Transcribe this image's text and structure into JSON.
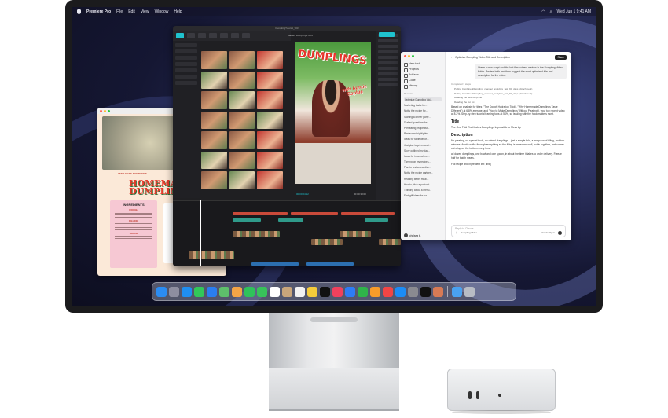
{
  "menubar": {
    "app_name": "Premiere Pro",
    "items": [
      "File",
      "Edit",
      "View",
      "Window",
      "Help"
    ],
    "clock": "Wed Jun 1  9:41 AM"
  },
  "recipe_doc": {
    "tag": "LET'S MAKE DUMPLINGS",
    "headline_line1": "HOMEMA",
    "headline_line2": "DUMPLINGS I",
    "card_title": "INGREDIENTS",
    "sections": [
      "DOUGH",
      "FILLING",
      "SAUCE"
    ]
  },
  "editor": {
    "window_title": "DumplingTutorial_v03",
    "preview_label": "Master: Dumplings.mp4",
    "preview_title": "DUMPLINGS",
    "preview_subtitle": "with Auntie Sophie",
    "timecode_current": "00:00:04:12",
    "timecode_total": "00:00:38:00"
  },
  "chat": {
    "sidebar_nav": [
      "New task",
      "Projects",
      "Artifacts",
      "Code",
      "History"
    ],
    "recents_label": "Recents",
    "history": [
      "Optimize Dumpling Vid...",
      "Marketing tasks for...",
      "Notify the recipe for...",
      "Starting a dinner party...",
      "Drafted questions for...",
      "Preheating recipe list...",
      "Restaurant highlights...",
      "Ideas for table decor...",
      "Just play together and...",
      "Story outlined my day...",
      "Ideas for informal me...",
      "Turning on my recipes...",
      "Plan to test a new dish...",
      "Notify the recipe partner...",
      "Reading better meal...",
      "How to pitch a podcast...",
      "Thinking about a menu...",
      "Find gift ideas for pa..."
    ],
    "user_name": "chelsea b.",
    "header_title": "Optimize Dumpling Video Title and Description",
    "share_label": "Share",
    "user_message": "I have a new script and the last film cut and metrics in the Dumpling Video folder. Review both and then suggest the most optimized title and description for the video.",
    "meta_label": "Completed 3 steps",
    "steps": [
      "Pulling Combined/dumpling_channel_analytics_last_90_days (Attachment)",
      "Pulling Combined/dumpling_channel_analytics_last_90_days (Attachment)",
      "Reading the new script file",
      "Reading the cut list"
    ],
    "body_intro": "Based on analysis for titles (\"The Dough Hydration Trick\", \"Why Homemade Dumplings Taste Different\") at 6.8% average, and \"How to Make Dumplings Without Pleating\"), your top recent video at 8.2%. Step-by-step tutorial framing tops at 54%, so leading with the hook matters most.",
    "title_heading": "Title",
    "title_value": "The One Fold That Makes Dumplings Impossible to Mess Up",
    "desc_heading": "Description",
    "desc_p1": "No pleating, no special tools, no ruined dumplings—just a simple fold, a teaspoon of filling, and two minutes. Auntie walks through everything so the filling is seasoned well, holds together, and comes out crisp on the bottom every time.",
    "desc_p2": "all dozen dumplings, one bowl and one spoon, in about the time it takes to order delivery. Freeze half for batch meals.",
    "desc_p3": "Full recipe and ingredient list: [link]",
    "input_placeholder": "Reply to Claude...",
    "input_project": "Dumpling Video",
    "input_model": "Claude Opus"
  },
  "dock": {
    "apps": [
      {
        "name": "finder",
        "color": "#2b8cf2"
      },
      {
        "name": "launchpad",
        "color": "#8e8ea0"
      },
      {
        "name": "safari",
        "color": "#1f8ef1"
      },
      {
        "name": "messages",
        "color": "#32c759"
      },
      {
        "name": "mail",
        "color": "#2a7df0"
      },
      {
        "name": "maps",
        "color": "#5ebf6b"
      },
      {
        "name": "photos",
        "color": "#f3a446"
      },
      {
        "name": "facetime",
        "color": "#2fc25b"
      },
      {
        "name": "phone",
        "color": "#38c25a"
      },
      {
        "name": "calendar",
        "color": "#ffffff"
      },
      {
        "name": "contacts",
        "color": "#c9a67b"
      },
      {
        "name": "reminders",
        "color": "#f2f2f2"
      },
      {
        "name": "notes",
        "color": "#f5cc3b"
      },
      {
        "name": "tv",
        "color": "#111111"
      },
      {
        "name": "music",
        "color": "#f0415d"
      },
      {
        "name": "keynote",
        "color": "#2d7cf6"
      },
      {
        "name": "numbers",
        "color": "#2fb34a"
      },
      {
        "name": "pages",
        "color": "#f79c2a"
      },
      {
        "name": "news",
        "color": "#f24545"
      },
      {
        "name": "app-store",
        "color": "#1c8cf6"
      },
      {
        "name": "system-settings",
        "color": "#8a8a90"
      },
      {
        "name": "capcut",
        "color": "#111111"
      },
      {
        "name": "claude",
        "color": "#d77a55"
      },
      {
        "name": "downloads",
        "color": "#4aa2f0"
      },
      {
        "name": "trash",
        "color": "#b8bcc4"
      }
    ]
  }
}
